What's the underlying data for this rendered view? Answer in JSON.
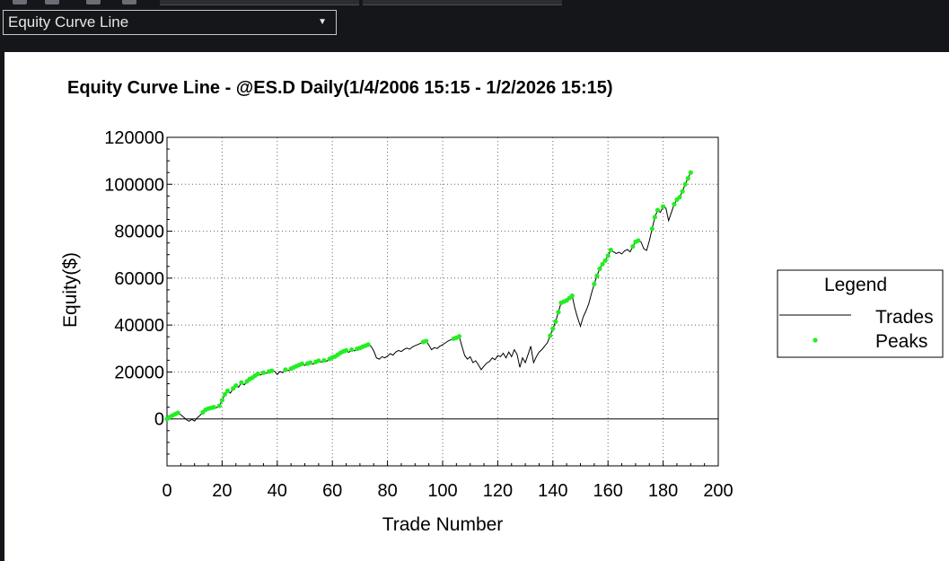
{
  "toolbar": {
    "view_selector": {
      "selected": "Equity Curve Line"
    }
  },
  "colors": {
    "trades_line": "#000000",
    "peaks": "#22ee22",
    "grid": "#666666"
  },
  "chart_data": {
    "type": "line",
    "title": "Equity Curve Line - @ES.D Daily(1/4/2006 15:15 - 1/2/2026 15:15)",
    "xlabel": "Trade Number",
    "ylabel": "Equity($)",
    "xlim": [
      0,
      200
    ],
    "ylim": [
      -20000,
      120000
    ],
    "x_ticks": [
      "0",
      "20",
      "40",
      "60",
      "80",
      "100",
      "120",
      "140",
      "160",
      "180",
      "200"
    ],
    "y_ticks": [
      "0",
      "20000",
      "40000",
      "60000",
      "80000",
      "100000",
      "120000"
    ],
    "grid": true,
    "legend": {
      "title": "Legend",
      "position": "right",
      "entries": [
        "Trades",
        "Peaks"
      ]
    },
    "series": [
      {
        "name": "Trades",
        "style": "line",
        "points": [
          [
            0,
            0
          ],
          [
            1,
            800
          ],
          [
            2,
            1500
          ],
          [
            3,
            2100
          ],
          [
            4,
            2600
          ],
          [
            5,
            1800
          ],
          [
            6,
            800
          ],
          [
            7,
            -300
          ],
          [
            8,
            -1000
          ],
          [
            9,
            -200
          ],
          [
            10,
            -900
          ],
          [
            11,
            500
          ],
          [
            12,
            1500
          ],
          [
            13,
            2800
          ],
          [
            14,
            3900
          ],
          [
            15,
            4400
          ],
          [
            16,
            4700
          ],
          [
            17,
            5000
          ],
          [
            18,
            4800
          ],
          [
            19,
            5600
          ],
          [
            20,
            8000
          ],
          [
            21,
            10500
          ],
          [
            22,
            12000
          ],
          [
            23,
            11000
          ],
          [
            24,
            13000
          ],
          [
            25,
            14200
          ],
          [
            26,
            13500
          ],
          [
            27,
            15500
          ],
          [
            28,
            14500
          ],
          [
            29,
            16000
          ],
          [
            30,
            17000
          ],
          [
            31,
            17600
          ],
          [
            32,
            18500
          ],
          [
            33,
            19200
          ],
          [
            34,
            18700
          ],
          [
            35,
            19700
          ],
          [
            36,
            19400
          ],
          [
            37,
            20200
          ],
          [
            38,
            20500
          ],
          [
            39,
            20300
          ],
          [
            40,
            19000
          ],
          [
            41,
            20200
          ],
          [
            42,
            19700
          ],
          [
            43,
            21000
          ],
          [
            44,
            20500
          ],
          [
            45,
            21400
          ],
          [
            46,
            22000
          ],
          [
            47,
            22500
          ],
          [
            48,
            23000
          ],
          [
            49,
            23500
          ],
          [
            50,
            22800
          ],
          [
            51,
            23600
          ],
          [
            52,
            24000
          ],
          [
            53,
            23300
          ],
          [
            54,
            24300
          ],
          [
            55,
            24800
          ],
          [
            56,
            24200
          ],
          [
            57,
            24900
          ],
          [
            58,
            24600
          ],
          [
            59,
            25600
          ],
          [
            60,
            26200
          ],
          [
            61,
            26600
          ],
          [
            62,
            27400
          ],
          [
            63,
            28200
          ],
          [
            64,
            28800
          ],
          [
            65,
            29200
          ],
          [
            66,
            28400
          ],
          [
            67,
            29500
          ],
          [
            68,
            29000
          ],
          [
            69,
            29900
          ],
          [
            70,
            30200
          ],
          [
            71,
            30800
          ],
          [
            72,
            31200
          ],
          [
            73,
            31700
          ],
          [
            74,
            31000
          ],
          [
            75,
            29000
          ],
          [
            76,
            26000
          ],
          [
            77,
            25500
          ],
          [
            78,
            26500
          ],
          [
            79,
            26000
          ],
          [
            80,
            26800
          ],
          [
            81,
            27800
          ],
          [
            82,
            27200
          ],
          [
            83,
            28500
          ],
          [
            84,
            29200
          ],
          [
            85,
            28700
          ],
          [
            86,
            29600
          ],
          [
            87,
            30200
          ],
          [
            88,
            29700
          ],
          [
            89,
            30600
          ],
          [
            90,
            31200
          ],
          [
            91,
            31700
          ],
          [
            92,
            32200
          ],
          [
            93,
            32800
          ],
          [
            94,
            33200
          ],
          [
            95,
            31500
          ],
          [
            96,
            29500
          ],
          [
            97,
            30400
          ],
          [
            98,
            30000
          ],
          [
            99,
            31000
          ],
          [
            100,
            31600
          ],
          [
            101,
            32400
          ],
          [
            102,
            33200
          ],
          [
            103,
            33700
          ],
          [
            104,
            34200
          ],
          [
            105,
            34600
          ],
          [
            106,
            35200
          ],
          [
            107,
            31000
          ],
          [
            108,
            27000
          ],
          [
            109,
            25500
          ],
          [
            110,
            26500
          ],
          [
            111,
            24000
          ],
          [
            112,
            24800
          ],
          [
            113,
            23000
          ],
          [
            114,
            21000
          ],
          [
            115,
            22500
          ],
          [
            116,
            23800
          ],
          [
            117,
            24500
          ],
          [
            118,
            26000
          ],
          [
            119,
            25200
          ],
          [
            120,
            27000
          ],
          [
            121,
            26500
          ],
          [
            122,
            28000
          ],
          [
            123,
            26000
          ],
          [
            124,
            28500
          ],
          [
            125,
            26500
          ],
          [
            126,
            29500
          ],
          [
            127,
            27500
          ],
          [
            128,
            22000
          ],
          [
            129,
            26000
          ],
          [
            130,
            24000
          ],
          [
            131,
            27500
          ],
          [
            132,
            31000
          ],
          [
            133,
            24000
          ],
          [
            134,
            26500
          ],
          [
            135,
            28500
          ],
          [
            136,
            29500
          ],
          [
            137,
            31000
          ],
          [
            138,
            32500
          ],
          [
            139,
            35500
          ],
          [
            140,
            38500
          ],
          [
            141,
            41500
          ],
          [
            142,
            45500
          ],
          [
            143,
            49500
          ],
          [
            144,
            50000
          ],
          [
            145,
            50500
          ],
          [
            146,
            51500
          ],
          [
            147,
            52500
          ],
          [
            148,
            47000
          ],
          [
            149,
            43000
          ],
          [
            150,
            39500
          ],
          [
            151,
            43500
          ],
          [
            152,
            46000
          ],
          [
            153,
            49000
          ],
          [
            154,
            53500
          ],
          [
            155,
            57500
          ],
          [
            156,
            61000
          ],
          [
            157,
            64000
          ],
          [
            158,
            66000
          ],
          [
            159,
            67500
          ],
          [
            160,
            69500
          ],
          [
            161,
            72000
          ],
          [
            162,
            71200
          ],
          [
            163,
            70500
          ],
          [
            164,
            71000
          ],
          [
            165,
            70300
          ],
          [
            166,
            71600
          ],
          [
            167,
            72200
          ],
          [
            168,
            71200
          ],
          [
            169,
            73500
          ],
          [
            170,
            75500
          ],
          [
            171,
            76000
          ],
          [
            172,
            75400
          ],
          [
            173,
            72500
          ],
          [
            174,
            71800
          ],
          [
            175,
            76000
          ],
          [
            176,
            81000
          ],
          [
            177,
            86000
          ],
          [
            178,
            89000
          ],
          [
            179,
            88000
          ],
          [
            180,
            90500
          ],
          [
            181,
            89800
          ],
          [
            182,
            84500
          ],
          [
            183,
            88000
          ],
          [
            184,
            91500
          ],
          [
            185,
            93500
          ],
          [
            186,
            94500
          ],
          [
            187,
            97000
          ],
          [
            188,
            100000
          ],
          [
            189,
            102500
          ],
          [
            190,
            105000
          ]
        ]
      },
      {
        "name": "Peaks",
        "style": "scatter",
        "points": [
          [
            0,
            0
          ],
          [
            1,
            800
          ],
          [
            2,
            1500
          ],
          [
            3,
            2100
          ],
          [
            4,
            2600
          ],
          [
            13,
            2800
          ],
          [
            14,
            3900
          ],
          [
            15,
            4400
          ],
          [
            16,
            4700
          ],
          [
            17,
            5000
          ],
          [
            19,
            5600
          ],
          [
            20,
            8000
          ],
          [
            21,
            10500
          ],
          [
            22,
            12000
          ],
          [
            24,
            13000
          ],
          [
            25,
            14200
          ],
          [
            27,
            15500
          ],
          [
            29,
            16000
          ],
          [
            30,
            17000
          ],
          [
            31,
            17600
          ],
          [
            32,
            18500
          ],
          [
            33,
            19200
          ],
          [
            35,
            19700
          ],
          [
            37,
            20200
          ],
          [
            38,
            20500
          ],
          [
            43,
            21000
          ],
          [
            45,
            21400
          ],
          [
            46,
            22000
          ],
          [
            47,
            22500
          ],
          [
            48,
            23000
          ],
          [
            49,
            23500
          ],
          [
            51,
            23600
          ],
          [
            52,
            24000
          ],
          [
            54,
            24300
          ],
          [
            55,
            24800
          ],
          [
            57,
            24900
          ],
          [
            59,
            25600
          ],
          [
            60,
            26200
          ],
          [
            61,
            26600
          ],
          [
            62,
            27400
          ],
          [
            63,
            28200
          ],
          [
            64,
            28800
          ],
          [
            65,
            29200
          ],
          [
            67,
            29500
          ],
          [
            69,
            29900
          ],
          [
            70,
            30200
          ],
          [
            71,
            30800
          ],
          [
            72,
            31200
          ],
          [
            73,
            31700
          ],
          [
            93,
            32800
          ],
          [
            94,
            33200
          ],
          [
            104,
            34200
          ],
          [
            105,
            34600
          ],
          [
            106,
            35200
          ],
          [
            139,
            35500
          ],
          [
            140,
            38500
          ],
          [
            141,
            41500
          ],
          [
            142,
            45500
          ],
          [
            143,
            49500
          ],
          [
            144,
            50000
          ],
          [
            145,
            50500
          ],
          [
            146,
            51500
          ],
          [
            147,
            52500
          ],
          [
            155,
            57500
          ],
          [
            156,
            61000
          ],
          [
            157,
            64000
          ],
          [
            158,
            66000
          ],
          [
            159,
            67500
          ],
          [
            160,
            69500
          ],
          [
            161,
            72000
          ],
          [
            169,
            73500
          ],
          [
            170,
            75500
          ],
          [
            171,
            76000
          ],
          [
            176,
            81000
          ],
          [
            177,
            86000
          ],
          [
            178,
            89000
          ],
          [
            180,
            90500
          ],
          [
            184,
            91500
          ],
          [
            185,
            93500
          ],
          [
            186,
            94500
          ],
          [
            187,
            97000
          ],
          [
            188,
            100000
          ],
          [
            189,
            102500
          ],
          [
            190,
            105000
          ]
        ]
      }
    ]
  }
}
